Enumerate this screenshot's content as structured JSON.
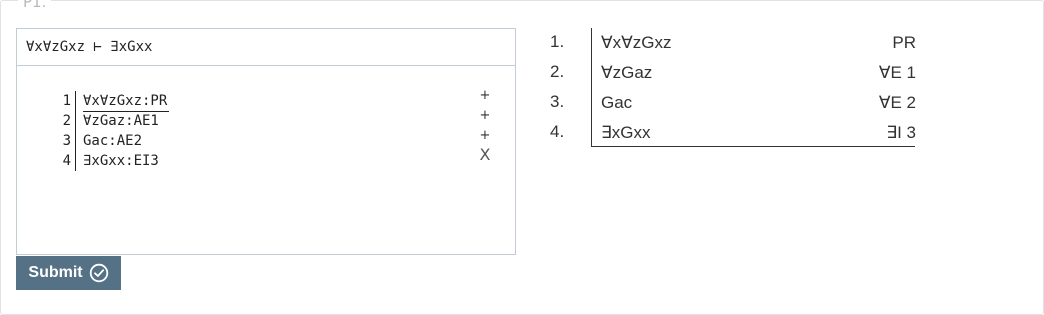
{
  "problem": {
    "label": "P1."
  },
  "editor": {
    "sequent": "∀x∀zGxz ⊢ ∃xGxx",
    "lines": [
      {
        "num": "1",
        "text": "∀x∀zGxz:PR",
        "mark": "+"
      },
      {
        "num": "2",
        "text": "∀zGaz:AE1",
        "mark": "+"
      },
      {
        "num": "3",
        "text": "Gac:AE2",
        "mark": "+"
      },
      {
        "num": "4",
        "text": "∃xGxx:EI3",
        "mark": "X"
      }
    ]
  },
  "submit": {
    "label": "Submit",
    "icon": "check-circle-icon"
  },
  "proof": {
    "rows": [
      {
        "num": "1.",
        "formula": "∀x∀zGxz",
        "just": "PR"
      },
      {
        "num": "2.",
        "formula": "∀zGaz",
        "just": "∀E 1"
      },
      {
        "num": "3.",
        "formula": "Gac",
        "just": "∀E 2"
      },
      {
        "num": "4.",
        "formula": "∃xGxx",
        "just": "∃I 3"
      }
    ]
  },
  "colors": {
    "button": "#557185",
    "border": "#c3ccd3"
  }
}
